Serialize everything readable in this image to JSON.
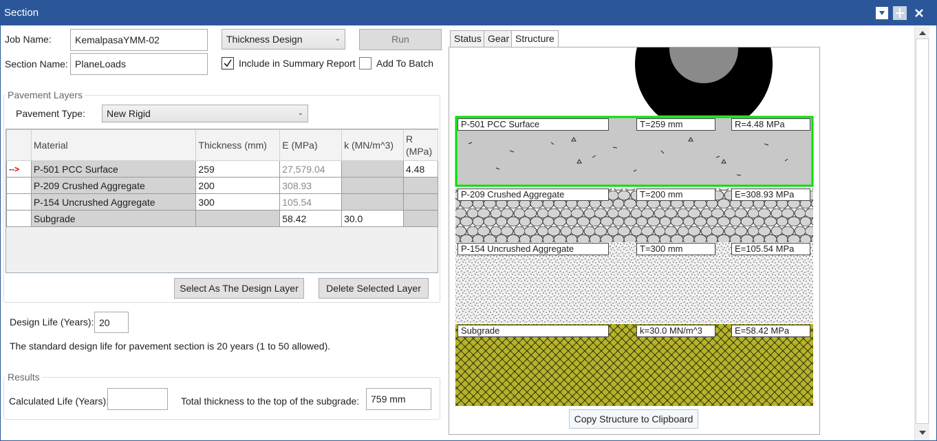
{
  "window": {
    "title": "Section"
  },
  "form": {
    "job_name_label": "Job Name:",
    "job_name_value": "KemalpasaYMM-02",
    "section_name_label": "Section Name:",
    "section_name_value": "PlaneLoads",
    "design_mode": "Thickness Design",
    "run_label": "Run",
    "include_summary_label": "Include in Summary Report",
    "include_summary_checked": true,
    "add_batch_label": "Add To Batch",
    "add_batch_checked": false
  },
  "pavement": {
    "group_label": "Pavement Layers",
    "type_label": "Pavement Type:",
    "type_value": "New Rigid",
    "columns": [
      "Material",
      "Thickness (mm)",
      "E (MPa)",
      "k (MN/m^3)",
      "R (MPa)"
    ],
    "rows": [
      {
        "marker": "-->",
        "material": "P-501 PCC Surface",
        "thickness": "259",
        "e": "27,579.04",
        "k": "",
        "r": "4.48"
      },
      {
        "marker": "",
        "material": "P-209 Crushed Aggregate",
        "thickness": "200",
        "e": "308.93",
        "k": "",
        "r": ""
      },
      {
        "marker": "",
        "material": "P-154 Uncrushed Aggregate",
        "thickness": "300",
        "e": "105.54",
        "k": "",
        "r": ""
      },
      {
        "marker": "",
        "material": "Subgrade",
        "thickness": "",
        "e": "58.42",
        "k": "30.0",
        "r": ""
      }
    ],
    "select_design_label": "Select As The Design Layer",
    "delete_label": "Delete Selected Layer"
  },
  "design_life": {
    "label": "Design Life (Years):",
    "value": "20",
    "note": "The standard design life for pavement section is 20 years (1 to 50 allowed)."
  },
  "results": {
    "group_label": "Results",
    "calc_life_label": "Calculated Life (Years):",
    "calc_life_value": "",
    "total_thickness_label": "Total thickness to the top of the subgrade:",
    "total_thickness_value": "759 mm"
  },
  "tabs": [
    "Status",
    "Gear",
    "Structure"
  ],
  "active_tab": "Structure",
  "structure": {
    "layers": [
      {
        "name": "P-501 PCC Surface",
        "thickness": "T=259 mm",
        "modulus": "R=4.48 MPa"
      },
      {
        "name": "P-209 Crushed Aggregate",
        "thickness": "T=200 mm",
        "modulus": "E=308.93 MPa"
      },
      {
        "name": "P-154 Uncrushed Aggregate",
        "thickness": "T=300 mm",
        "modulus": "E=105.54 MPa"
      },
      {
        "name": "Subgrade",
        "thickness": "k=30.0 MN/m^3",
        "modulus": "E=58.42 MPa"
      }
    ],
    "copy_label": "Copy Structure to Clipboard",
    "colors": {
      "pcc": "#c8c8c8",
      "highlight": "#00e000",
      "subgrade": "#b5b32a"
    }
  },
  "icons": [
    "dropdown-icon",
    "pin-icon",
    "close-icon",
    "scroll-up-icon",
    "scroll-down-icon",
    "check-icon",
    "row-pointer-icon"
  ]
}
